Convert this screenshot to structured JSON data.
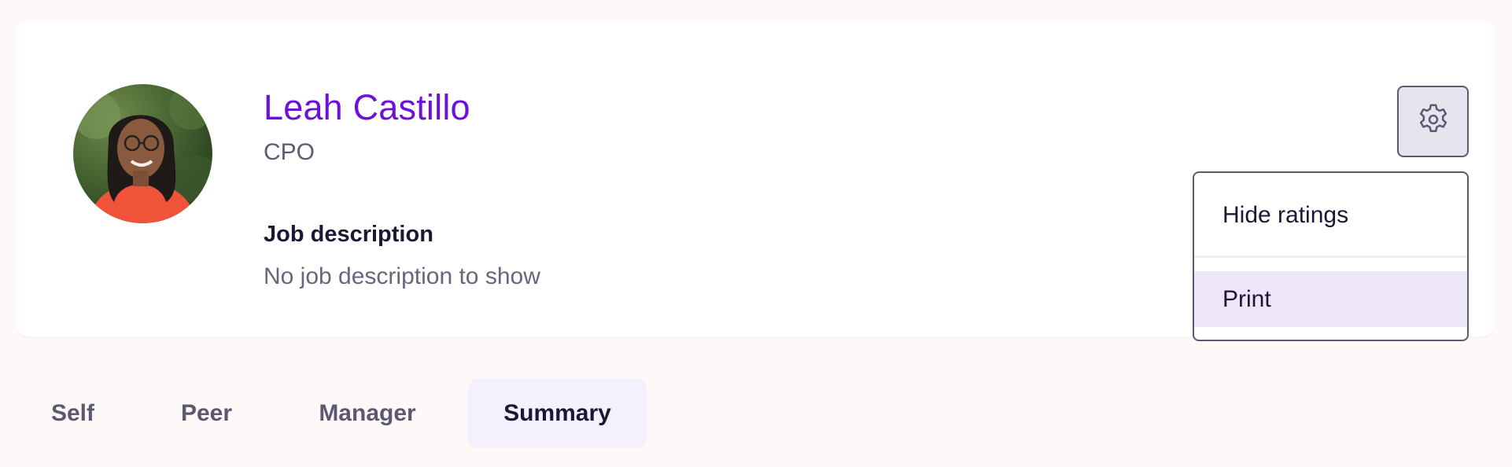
{
  "profile": {
    "name": "Leah Castillo",
    "role": "CPO",
    "job_description_title": "Job description",
    "job_description_text": "No job description to show"
  },
  "settings": {
    "icon": "gear-icon",
    "menu": [
      {
        "label": "Hide ratings",
        "highlighted": false
      },
      {
        "label": "Print",
        "highlighted": true
      }
    ]
  },
  "tabs": [
    {
      "label": "Self",
      "active": false
    },
    {
      "label": "Peer",
      "active": false
    },
    {
      "label": "Manager",
      "active": false
    },
    {
      "label": "Summary",
      "active": true
    }
  ],
  "colors": {
    "accent": "#6d10d9",
    "active_tab_bg": "#f4f1fd",
    "menu_highlight": "#ece6f8",
    "background": "#fdf9f8"
  }
}
